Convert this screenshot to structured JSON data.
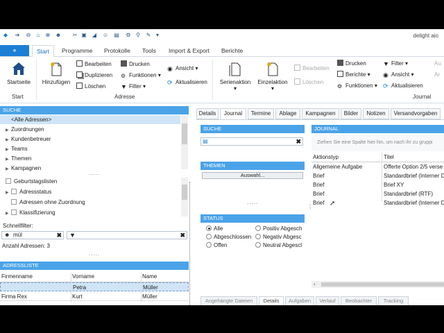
{
  "app_title": "delight aio",
  "tabs": {
    "file": "",
    "start": "Start",
    "programme": "Programme",
    "protokolle": "Protokolle",
    "tools": "Tools",
    "import_export": "Import & Export",
    "berichte": "Berichte"
  },
  "ribbon": {
    "startseite": "Startseite",
    "hinzufuegen": "Hinzufügen",
    "bearbeiten": "Bearbeiten",
    "duplizieren": "Duplizieren",
    "loeschen": "Löschen",
    "drucken": "Drucken",
    "funktionen": "Funktionen",
    "filter": "Filter",
    "ansicht": "Ansicht",
    "aktualisieren": "Aktualisieren",
    "serienaktion": "Serienaktion",
    "einzelaktion": "Einzelaktion",
    "bearbeiten2": "Bearbeiten",
    "loeschen2": "Löschen",
    "drucken2": "Drucken",
    "berichte": "Berichte",
    "funktionen2": "Funktionen",
    "filter2": "Filter",
    "ansicht2": "Ansicht",
    "aktualisieren2": "Aktualisieren",
    "a1": "Au",
    "a2": "Ar",
    "group_start": "Start",
    "group_adresse": "Adresse",
    "group_journal": "Journal"
  },
  "suche": {
    "header": "SUCHE",
    "tree1": [
      "<Alle Adressen>",
      "Zuordnungen",
      "Kundenbetreuer",
      "Teams",
      "Themen",
      "Kampagnen"
    ],
    "tree2": [
      "Geburtstagslisten",
      "Adressstatus",
      "Adressen ohne Zuordnung",
      "Klassifizierung"
    ],
    "schnellfilter_label": "Schnellfilter:",
    "schnellfilter_value": "mül",
    "anzahl": "Anzahl Adressen: 3",
    "dots": "....."
  },
  "adressliste": {
    "header": "ADRESSLISTE",
    "columns": [
      "Firmenname",
      "Vorname",
      "Name"
    ],
    "rows": [
      [
        "",
        "Petra",
        "Müller"
      ],
      [
        "Firma Rex",
        "Kurt",
        "Müller"
      ]
    ]
  },
  "detail_tabs": [
    "Details",
    "Journal",
    "Termine",
    "Ablage",
    "Kampagnen",
    "Bilder",
    "Notizen",
    "Versandvorgaben"
  ],
  "bottom_tabs": [
    "Angehängte Dateien",
    "Details",
    "Aufgaben",
    "Verlauf",
    "Beobachter",
    "Tracking"
  ],
  "journal_suche": {
    "header": "SUCHE",
    "input_value": ""
  },
  "themen": {
    "header": "THEMEN",
    "button": "Auswahl..."
  },
  "status": {
    "header": "STATUS",
    "options_left": [
      "Alle",
      "Abgeschlossen",
      "Offen"
    ],
    "options_right": [
      "Positiv Abgesch",
      "Negativ Abgesc",
      "Neutral Abgescl"
    ],
    "selected": "Alle"
  },
  "journal": {
    "header": "JOURNAL",
    "group_hint": "Ziehen Sie eine Spalte hier hin, um nach ihr zu gruppi",
    "columns": [
      "Aktionstyp",
      "Titel"
    ],
    "rows": [
      [
        "Allgemeine Aufgabe",
        "Offerte Option 2/5 verse"
      ],
      [
        "Brief",
        "Standardbrief (Interner D"
      ],
      [
        "Brief",
        "Brief XY"
      ],
      [
        "Brief",
        "Standardbrief (RTF)"
      ],
      [
        "Brief",
        "Standardbrief (Interner D"
      ]
    ]
  },
  "colors": {
    "accent": "#1b7fd6",
    "panel_header": "#4aa3e8",
    "selected_row": "#cfe5f7"
  }
}
